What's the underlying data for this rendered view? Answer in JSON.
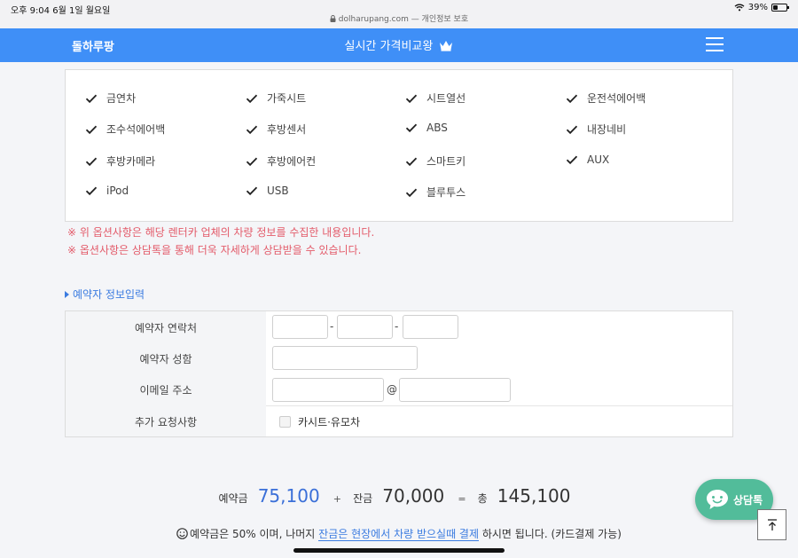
{
  "statusbar": {
    "time": "오후 9:04   6월 1일 월요일",
    "url": "dolharupang.com — 개인정보 보호",
    "battery": "39%",
    "battery_level": 0.39
  },
  "navbar": {
    "brand": "돌하루팡",
    "title": "실시간 가격비교왕"
  },
  "options": [
    "금연차",
    "가죽시트",
    "시트열선",
    "운전석에어백",
    "조수석에어백",
    "후방센서",
    "ABS",
    "내장네비",
    "후방카메라",
    "후방에어컨",
    "스마트키",
    "AUX",
    "iPod",
    "USB",
    "블루투스"
  ],
  "notes": [
    "※ 위 옵션사항은 해당 렌터카 업체의 차량 정보를 수집한 내용입니다.",
    "※ 옵션사항은 상담톡을 통해 더욱 자세하게 상담받을 수 있습니다."
  ],
  "reservation": {
    "section_title": "예약자 정보입력",
    "labels": {
      "phone": "예약자 연락처",
      "name": "예약자 성함",
      "email": "이메일 주소",
      "request": "추가 요청사항"
    },
    "phone_sep": "-",
    "email_sep": "@",
    "request_option": "카시트·유모차"
  },
  "price": {
    "deposit_label": "예약금",
    "deposit": "75,100",
    "plus": "+",
    "balance_label": "잔금",
    "balance": "70,000",
    "equals": "=",
    "total_label": "총",
    "total": "145,100"
  },
  "deposit_note": {
    "before": "예약금은 50% 이며, 나머지 ",
    "link": "잔금은 현장에서 차량 받으실때 결제",
    "after": " 하시면 됩니다. (카드결제 가능)"
  },
  "chat": {
    "label": "상담톡"
  },
  "colors": {
    "nav": "#3f8ff7",
    "notes": "#e35b6a",
    "link": "#3a7be0",
    "chat": "#52bc9a"
  }
}
